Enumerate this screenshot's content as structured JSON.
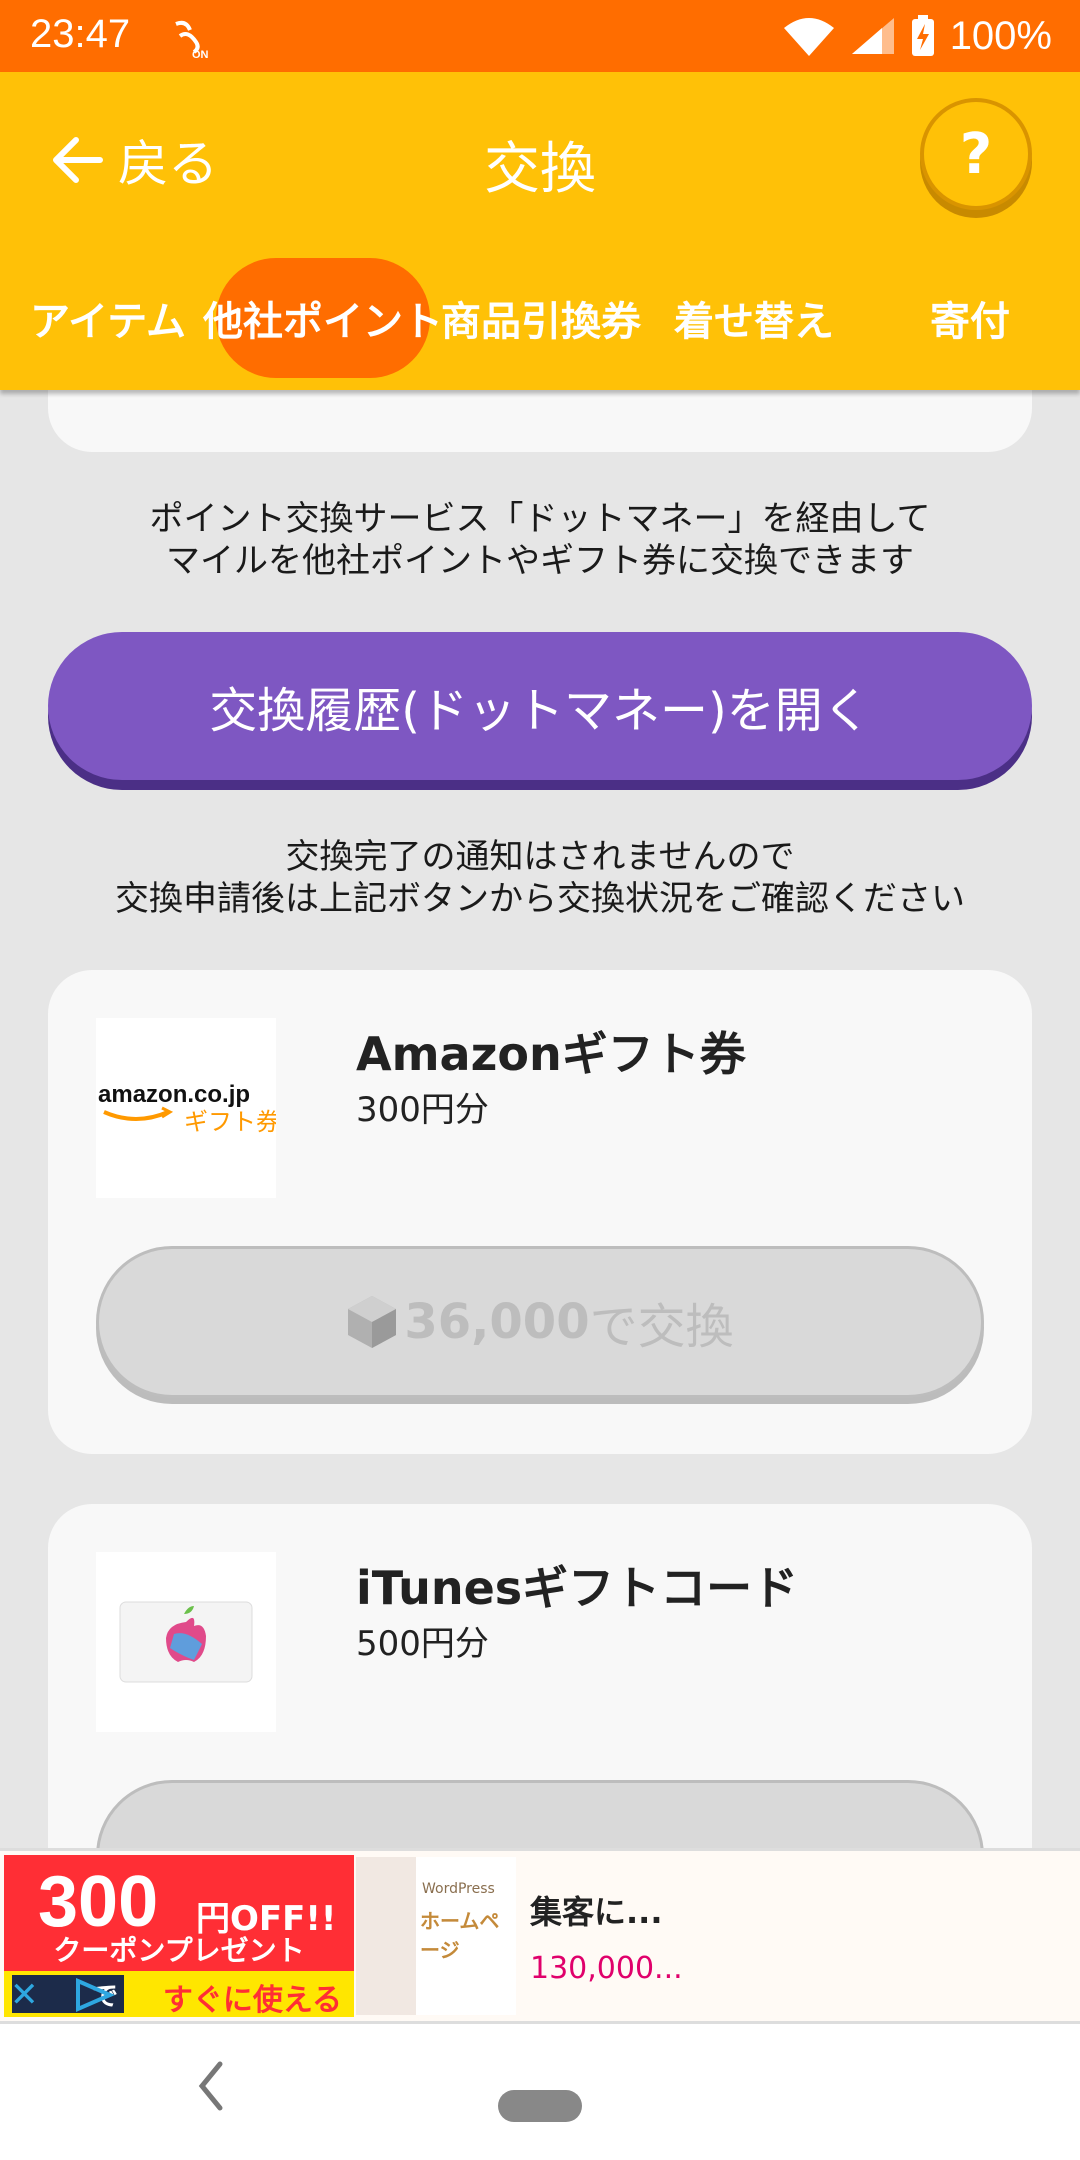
{
  "status_bar": {
    "time": "23:47",
    "battery": "100%"
  },
  "header": {
    "back_label": "戻る",
    "title": "交換",
    "help_label": "?"
  },
  "tabs": [
    {
      "label": "アイテム",
      "active": false
    },
    {
      "label": "他社ポイント",
      "active": true
    },
    {
      "label": "商品引換券",
      "active": false
    },
    {
      "label": "着せ替え",
      "active": false
    },
    {
      "label": "寄付",
      "active": false
    }
  ],
  "info": {
    "line1": "ポイント交換サービス「ドットマネー」を経由して",
    "line2": "マイルを他社ポイントやギフト券に交換できます"
  },
  "history_button": "交換履歴(ドットマネー)を開く",
  "notice": {
    "line1": "交換完了の通知はされませんので",
    "line2": "交換申請後は上記ボタンから交換状況をご確認ください"
  },
  "cards": [
    {
      "title": "Amazonギフト券",
      "amount": "300円分",
      "logo_text": "amazon.co.jp",
      "logo_sub": "ギフト券",
      "cost": "36,000",
      "cost_suffix": " で交換"
    },
    {
      "title": "iTunesギフトコード",
      "amount": "500円分",
      "cost": "",
      "cost_suffix": ""
    }
  ],
  "ad": {
    "big": "300",
    "yen": "円OFF!!",
    "coupon": "クーポンプレゼント",
    "cta_dark": "で",
    "cta": "すぐに使える",
    "thumb_small": "WordPress",
    "thumb_title": "ホームページ",
    "title": "集客に...",
    "price": "130,000..."
  }
}
